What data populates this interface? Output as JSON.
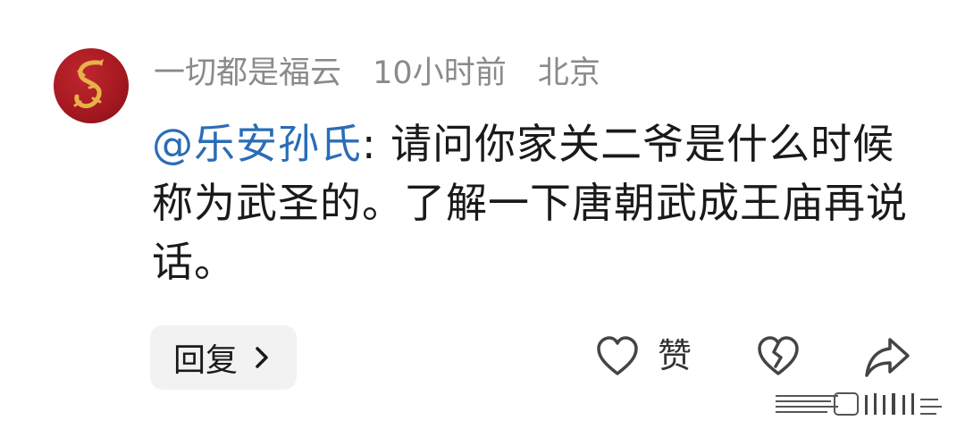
{
  "comment": {
    "author": "一切都是福云",
    "time": "10小时前",
    "location": "北京",
    "mention": "@乐安孙氏",
    "text": ": 请问你家关二爷是什么时候称为武圣的。了解一下唐朝武成王庙再说话。"
  },
  "actions": {
    "reply_label": "回复",
    "like_label": "赞"
  },
  "icons": {
    "avatar": "dragon-avatar",
    "reply_chevron": "chevron-right-icon",
    "like": "heart-outline-icon",
    "dislike": "broken-heart-icon",
    "share": "share-arrow-icon"
  },
  "colors": {
    "mention": "#2a6db5",
    "meta": "#8a8a8a",
    "avatar_bg": "#a41820",
    "avatar_fg": "#e8b04a"
  }
}
